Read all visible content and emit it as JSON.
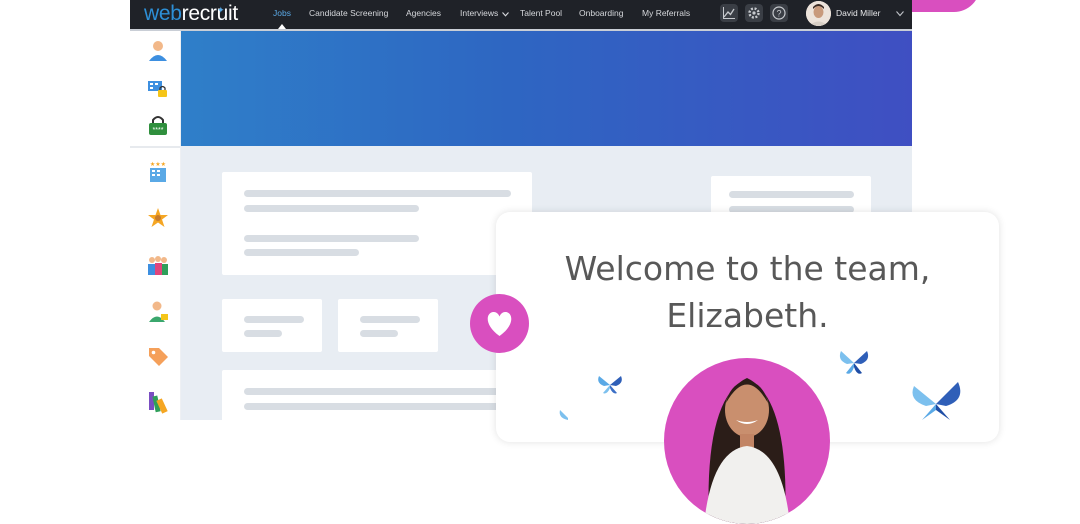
{
  "app": {
    "logo_web": "web",
    "logo_recruit": "recruit"
  },
  "nav": {
    "items": [
      {
        "label": "Jobs",
        "active": true
      },
      {
        "label": "Candidate Screening"
      },
      {
        "label": "Agencies"
      },
      {
        "label": "Interviews"
      },
      {
        "label": "Talent Pool"
      },
      {
        "label": "Onboarding"
      },
      {
        "label": "My Referrals"
      }
    ],
    "icons": [
      "chart-icon",
      "gear-icon",
      "help-icon"
    ]
  },
  "user": {
    "name": "David Miller"
  },
  "sidebar": {
    "icons": [
      "user-icon",
      "org-lock-icon",
      "admin-lock-icon",
      "rated-company-icon",
      "star-badge-icon",
      "team-icon",
      "employee-icon",
      "tag-icon",
      "palette-icon"
    ]
  },
  "welcome": {
    "line1": "Welcome to the team,",
    "line2": "Elizabeth."
  },
  "colors": {
    "nav_bg": "#1f2228",
    "accent_blue": "#2d8fd6",
    "brand_pink": "#d94fbf",
    "hero_start": "#2f7fc9",
    "hero_end": "#3f4fc2"
  }
}
